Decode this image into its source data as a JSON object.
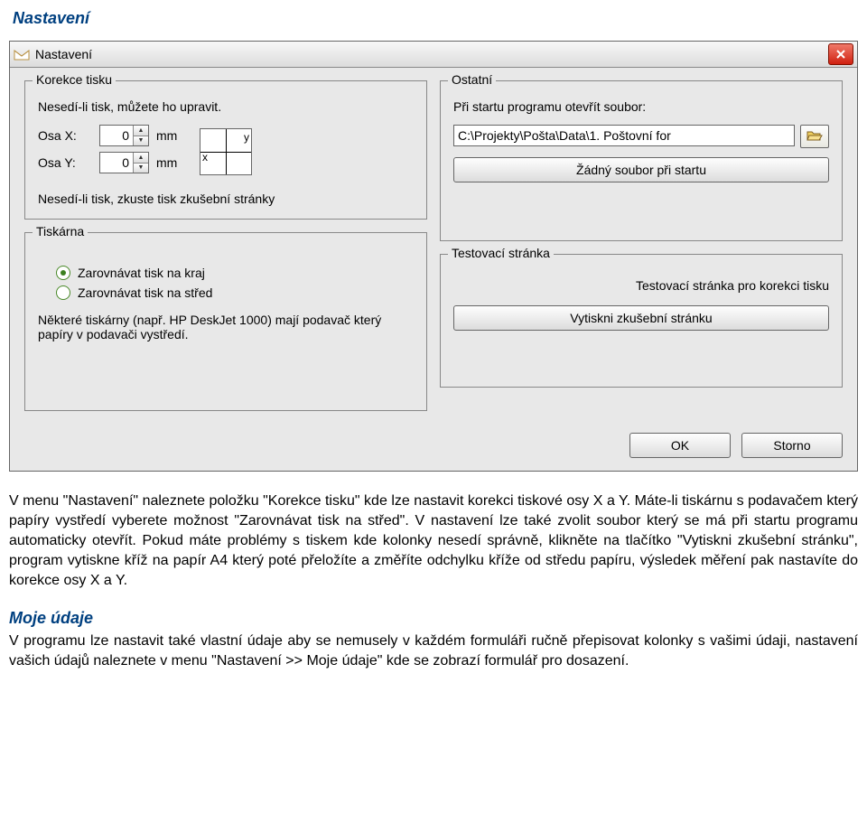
{
  "page_heading": "Nastavení",
  "dialog": {
    "title": "Nastavení",
    "groups": {
      "korekce": {
        "legend": "Korekce tisku",
        "desc": "Nesedí-li tisk, můžete ho upravit.",
        "axis_x_label": "Osa X:",
        "axis_x_value": "0",
        "axis_x_unit": "mm",
        "axis_y_label": "Osa Y:",
        "axis_y_value": "0",
        "axis_y_unit": "mm",
        "xy_y": "y",
        "xy_x": "x",
        "note": "Nesedí-li tisk, zkuste tisk zkušební stránky"
      },
      "tiskarna": {
        "legend": "Tiskárna",
        "option_edge": "Zarovnávat tisk na kraj",
        "option_center": "Zarovnávat tisk na střed",
        "note": "Některé tiskárny (např. HP DeskJet 1000) mají podavač který papíry v podavači vystředí."
      },
      "ostatni": {
        "legend": "Ostatní",
        "desc": "Při startu programu otevřít soubor:",
        "path": "C:\\Projekty\\Pošta\\Data\\1. Poštovní for",
        "no_file_btn": "Žádný soubor při startu"
      },
      "test": {
        "legend": "Testovací stránka",
        "desc": "Testovací stránka pro korekci tisku",
        "print_btn": "Vytiskni zkušební stránku"
      }
    },
    "ok": "OK",
    "cancel": "Storno"
  },
  "body_text_1": "V menu \"Nastavení\" naleznete položku \"Korekce tisku\" kde lze nastavit korekci tiskové osy X a Y. Máte-li tiskárnu s podavačem který papíry vystředí vyberete možnost \"Zarovnávat tisk na střed\". V nastavení lze také zvolit soubor který se má při startu programu automaticky otevřít. Pokud máte problémy s tiskem kde kolonky nesedí správně, klikněte na tlačítko \"Vytiskni zkušební stránku\", program vytiskne kříž na papír A4 který poté přeložíte a změříte odchylku kříže od středu papíru, výsledek měření pak nastavíte do korekce osy X a Y.",
  "subheading": "Moje údaje",
  "body_text_2": "V programu lze nastavit také vlastní údaje aby se nemusely v každém formuláři ručně přepisovat kolonky s vašimi údaji, nastavení vašich údajů naleznete v menu \"Nastavení >> Moje údaje\" kde se zobrazí formulář pro dosazení."
}
